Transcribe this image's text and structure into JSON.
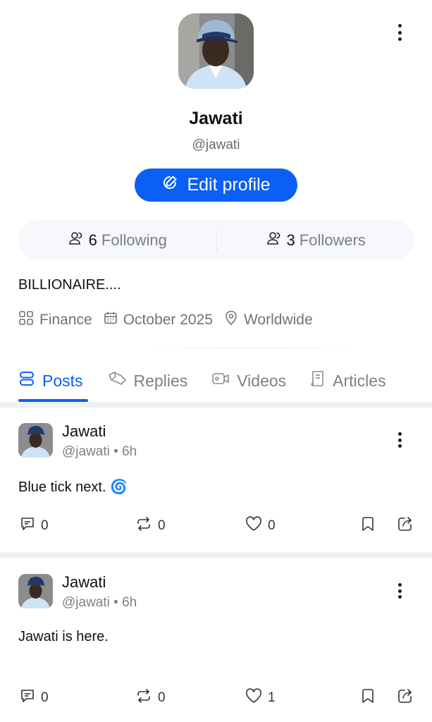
{
  "profile": {
    "name": "Jawati",
    "handle": "@jawati",
    "edit_label": "Edit profile",
    "following_count": "6",
    "following_label": "Following",
    "followers_count": "3",
    "followers_label": "Followers",
    "bio": "BILLIONAIRE....",
    "category": "Finance",
    "joined": "October 2025",
    "location": "Worldwide"
  },
  "tabs": [
    {
      "label": "Posts",
      "active": true
    },
    {
      "label": "Replies",
      "active": false
    },
    {
      "label": "Videos",
      "active": false
    },
    {
      "label": "Articles",
      "active": false
    }
  ],
  "posts": [
    {
      "name": "Jawati",
      "handle_time": "@jawati • 6h",
      "text": "Blue tick next. 🌀",
      "comments": "0",
      "reposts": "0",
      "likes": "0"
    },
    {
      "name": "Jawati",
      "handle_time": "@jawati • 6h",
      "text": "Jawati is here.",
      "comments": "0",
      "reposts": "0",
      "likes": "1"
    }
  ],
  "colors": {
    "accent": "#0b5ff5",
    "muted": "#7c8087",
    "band": "#eef2f7",
    "stats_bg": "#f6f8fb"
  },
  "icons": [
    "more-vertical-icon",
    "edit-icon",
    "users-icon",
    "grid-icon",
    "calendar-icon",
    "map-pin-icon",
    "posts-icon",
    "replies-icon",
    "video-icon",
    "article-icon",
    "comment-icon",
    "repost-icon",
    "heart-icon",
    "bookmark-icon",
    "share-icon"
  ]
}
